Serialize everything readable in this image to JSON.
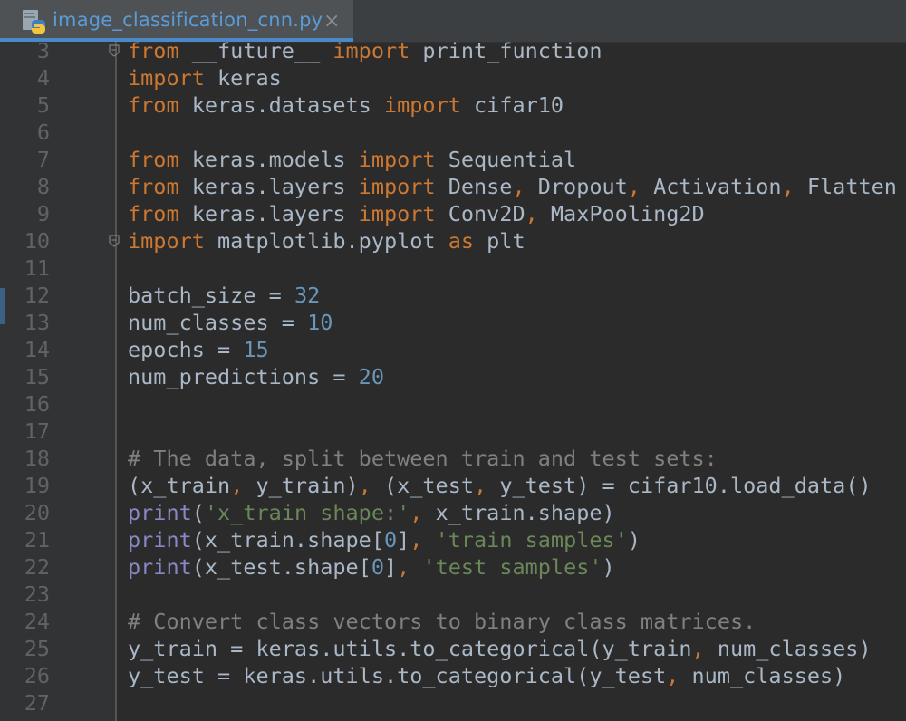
{
  "editor": {
    "tab_title": "image_classification_cnn.py",
    "tab_close_glyph": "×",
    "file_icon": "python-file-icon"
  },
  "theme": {
    "background": "#2b2b2b",
    "keyword": "#cc7832",
    "number": "#6897bb",
    "string": "#6a8759",
    "comment": "#808080",
    "builtin": "#8888c6",
    "text": "#a9b7c6"
  },
  "lines": [
    {
      "n": "3",
      "fold": true,
      "tokens": [
        [
          "kw",
          "from"
        ],
        [
          "t",
          " __future__ "
        ],
        [
          "kw",
          "import"
        ],
        [
          "t",
          " print_function"
        ]
      ]
    },
    {
      "n": "4",
      "tokens": [
        [
          "kw",
          "import"
        ],
        [
          "t",
          " keras"
        ]
      ]
    },
    {
      "n": "5",
      "tokens": [
        [
          "kw",
          "from"
        ],
        [
          "t",
          " keras.datasets "
        ],
        [
          "kw",
          "import"
        ],
        [
          "t",
          " cifar10"
        ]
      ]
    },
    {
      "n": "6",
      "tokens": []
    },
    {
      "n": "7",
      "tokens": [
        [
          "kw",
          "from"
        ],
        [
          "t",
          " keras.models "
        ],
        [
          "kw",
          "import"
        ],
        [
          "t",
          " Sequential"
        ]
      ]
    },
    {
      "n": "8",
      "tokens": [
        [
          "kw",
          "from"
        ],
        [
          "t",
          " keras.layers "
        ],
        [
          "kw",
          "import"
        ],
        [
          "t",
          " Dense"
        ],
        [
          "pun",
          ", "
        ],
        [
          "t",
          "Dropout"
        ],
        [
          "pun",
          ", "
        ],
        [
          "t",
          "Activation"
        ],
        [
          "pun",
          ", "
        ],
        [
          "t",
          "Flatten"
        ]
      ]
    },
    {
      "n": "9",
      "tokens": [
        [
          "kw",
          "from"
        ],
        [
          "t",
          " keras.layers "
        ],
        [
          "kw",
          "import"
        ],
        [
          "t",
          " Conv2D"
        ],
        [
          "pun",
          ", "
        ],
        [
          "t",
          "MaxPooling2D"
        ]
      ]
    },
    {
      "n": "10",
      "fold": true,
      "tokens": [
        [
          "kw",
          "import"
        ],
        [
          "t",
          " matplotlib.pyplot "
        ],
        [
          "kw",
          "as"
        ],
        [
          "t",
          " plt"
        ]
      ]
    },
    {
      "n": "11",
      "tokens": []
    },
    {
      "n": "12",
      "tokens": [
        [
          "t",
          "batch_size = "
        ],
        [
          "num",
          "32"
        ]
      ]
    },
    {
      "n": "13",
      "tokens": [
        [
          "t",
          "num_classes = "
        ],
        [
          "num",
          "10"
        ]
      ]
    },
    {
      "n": "14",
      "tokens": [
        [
          "t",
          "epochs = "
        ],
        [
          "num",
          "15"
        ]
      ]
    },
    {
      "n": "15",
      "tokens": [
        [
          "t",
          "num_predictions = "
        ],
        [
          "num",
          "20"
        ]
      ]
    },
    {
      "n": "16",
      "tokens": []
    },
    {
      "n": "17",
      "tokens": []
    },
    {
      "n": "18",
      "tokens": [
        [
          "cmt",
          "# The data, split between train and test sets:"
        ]
      ]
    },
    {
      "n": "19",
      "tokens": [
        [
          "t",
          "(x_train"
        ],
        [
          "pun",
          ", "
        ],
        [
          "t",
          "y_train)"
        ],
        [
          "pun",
          ", "
        ],
        [
          "t",
          "(x_test"
        ],
        [
          "pun",
          ", "
        ],
        [
          "t",
          "y_test) = cifar10.load_data()"
        ]
      ]
    },
    {
      "n": "20",
      "tokens": [
        [
          "bi",
          "print"
        ],
        [
          "t",
          "("
        ],
        [
          "str",
          "'x_train shape:'"
        ],
        [
          "pun",
          ", "
        ],
        [
          "t",
          "x_train.shape)"
        ]
      ]
    },
    {
      "n": "21",
      "tokens": [
        [
          "bi",
          "print"
        ],
        [
          "t",
          "(x_train.shape["
        ],
        [
          "num",
          "0"
        ],
        [
          "t",
          "]"
        ],
        [
          "pun",
          ", "
        ],
        [
          "str",
          "'train samples'"
        ],
        [
          "t",
          ")"
        ]
      ]
    },
    {
      "n": "22",
      "tokens": [
        [
          "bi",
          "print"
        ],
        [
          "t",
          "(x_test.shape["
        ],
        [
          "num",
          "0"
        ],
        [
          "t",
          "]"
        ],
        [
          "pun",
          ", "
        ],
        [
          "str",
          "'test samples'"
        ],
        [
          "t",
          ")"
        ]
      ]
    },
    {
      "n": "23",
      "tokens": []
    },
    {
      "n": "24",
      "tokens": [
        [
          "cmt",
          "# Convert class vectors to binary class matrices."
        ]
      ]
    },
    {
      "n": "25",
      "tokens": [
        [
          "t",
          "y_train = keras.utils.to_categorical(y_train"
        ],
        [
          "pun",
          ", "
        ],
        [
          "t",
          "num_classes)"
        ]
      ]
    },
    {
      "n": "26",
      "tokens": [
        [
          "t",
          "y_test = keras.utils.to_categorical(y_test"
        ],
        [
          "pun",
          ", "
        ],
        [
          "t",
          "num_classes)"
        ]
      ]
    },
    {
      "n": "27",
      "tokens": []
    }
  ]
}
